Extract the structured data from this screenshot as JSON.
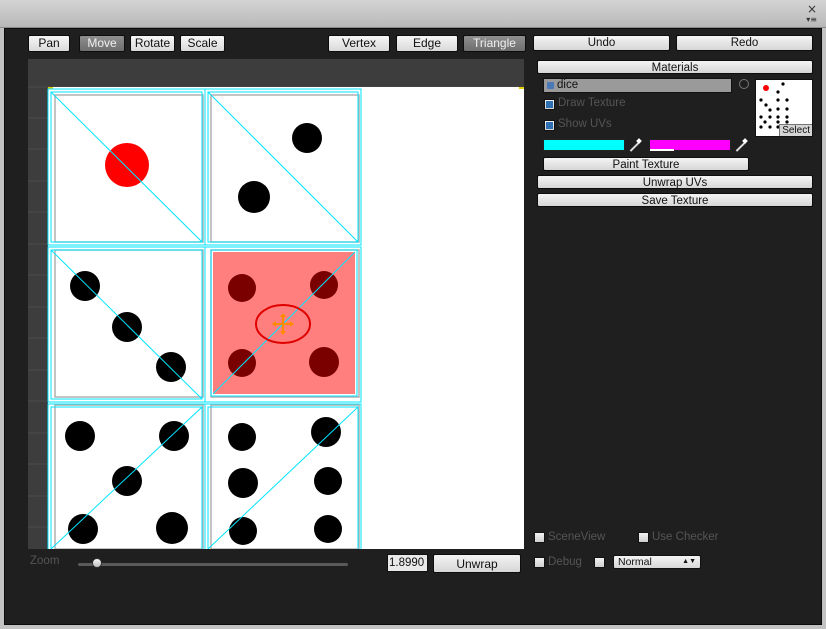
{
  "window": {
    "close_glyph": "×",
    "menu_glyph": "▾≡"
  },
  "toolbar": {
    "pan": "Pan",
    "move": "Move",
    "rotate": "Rotate",
    "scale": "Scale",
    "vertex": "Vertex",
    "edge": "Edge",
    "triangle": "Triangle",
    "active_tool": "Move",
    "active_mode": "Triangle"
  },
  "history": {
    "undo": "Undo",
    "redo": "Redo"
  },
  "materials": {
    "header": "Materials",
    "texture_name": "dice",
    "draw_texture_label": "Draw Texture",
    "draw_texture_checked": true,
    "show_uvs_label": "Show UVs",
    "show_uvs_checked": true,
    "color1": "#00ffff",
    "color2": "#ff00ff",
    "paint_texture": "Paint Texture",
    "unwrap_uvs": "Unwrap UVs",
    "save_texture": "Save Texture",
    "preview_select": "Select"
  },
  "bottom": {
    "zoom_label": "Zoom",
    "zoom_level_fraction": 0.07,
    "zoom_value": "1.8990",
    "unwrap": "Unwrap",
    "scene_view_label": "SceneView",
    "use_checker_label": "Use Checker",
    "debug_label": "Debug",
    "mode_select": "Normal"
  },
  "colors": {
    "uv_lines": "#00e5ff",
    "selected_fill": "#ff7f7f",
    "selected_outline": "#e00000",
    "pivot": "#ff8c00",
    "die_one_dot": "#ff0000",
    "panel_bg": "#1f1f1f"
  }
}
